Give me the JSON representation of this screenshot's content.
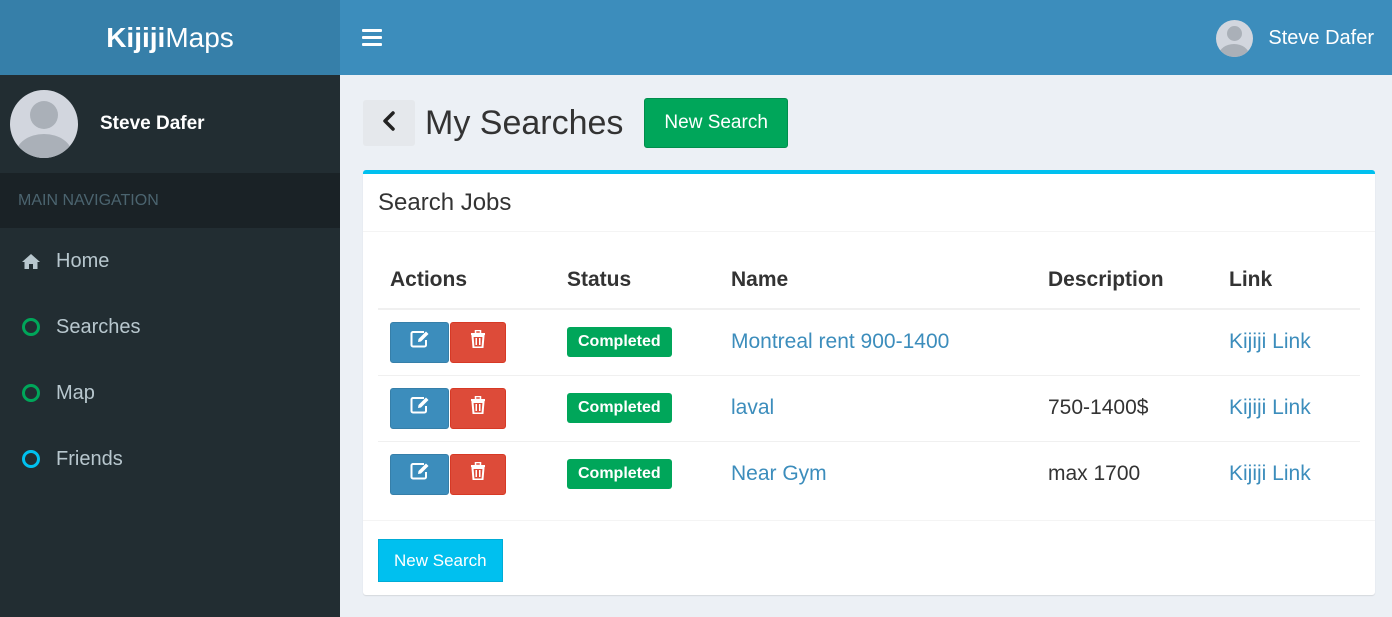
{
  "app": {
    "logo_bold": "Kijiji",
    "logo_light": "Maps"
  },
  "sidebar": {
    "user_name": "Steve Dafer",
    "nav_header": "MAIN NAVIGATION",
    "items": [
      {
        "label": "Home",
        "icon": "home-icon"
      },
      {
        "label": "Searches",
        "icon": "circle-green-icon"
      },
      {
        "label": "Map",
        "icon": "circle-green-icon"
      },
      {
        "label": "Friends",
        "icon": "circle-aqua-icon"
      }
    ]
  },
  "header": {
    "user_name": "Steve Dafer"
  },
  "page": {
    "title": "My Searches",
    "new_search_label": "New Search"
  },
  "box": {
    "title": "Search Jobs",
    "columns": [
      "Actions",
      "Status",
      "Name",
      "Description",
      "Link"
    ],
    "rows": [
      {
        "status": "Completed",
        "name": "Montreal rent 900-1400",
        "description": "",
        "link": "Kijiji Link"
      },
      {
        "status": "Completed",
        "name": "laval",
        "description": "750-1400$",
        "link": "Kijiji Link"
      },
      {
        "status": "Completed",
        "name": "Near Gym",
        "description": "max 1700",
        "link": "Kijiji Link"
      }
    ],
    "footer_button": "New Search"
  },
  "colors": {
    "header_blue": "#3c8dbc",
    "logo_blue": "#367fa9",
    "sidebar_dark": "#222d32",
    "success_green": "#00a65a",
    "danger_red": "#dd4b39",
    "info_aqua": "#00c0ef"
  }
}
